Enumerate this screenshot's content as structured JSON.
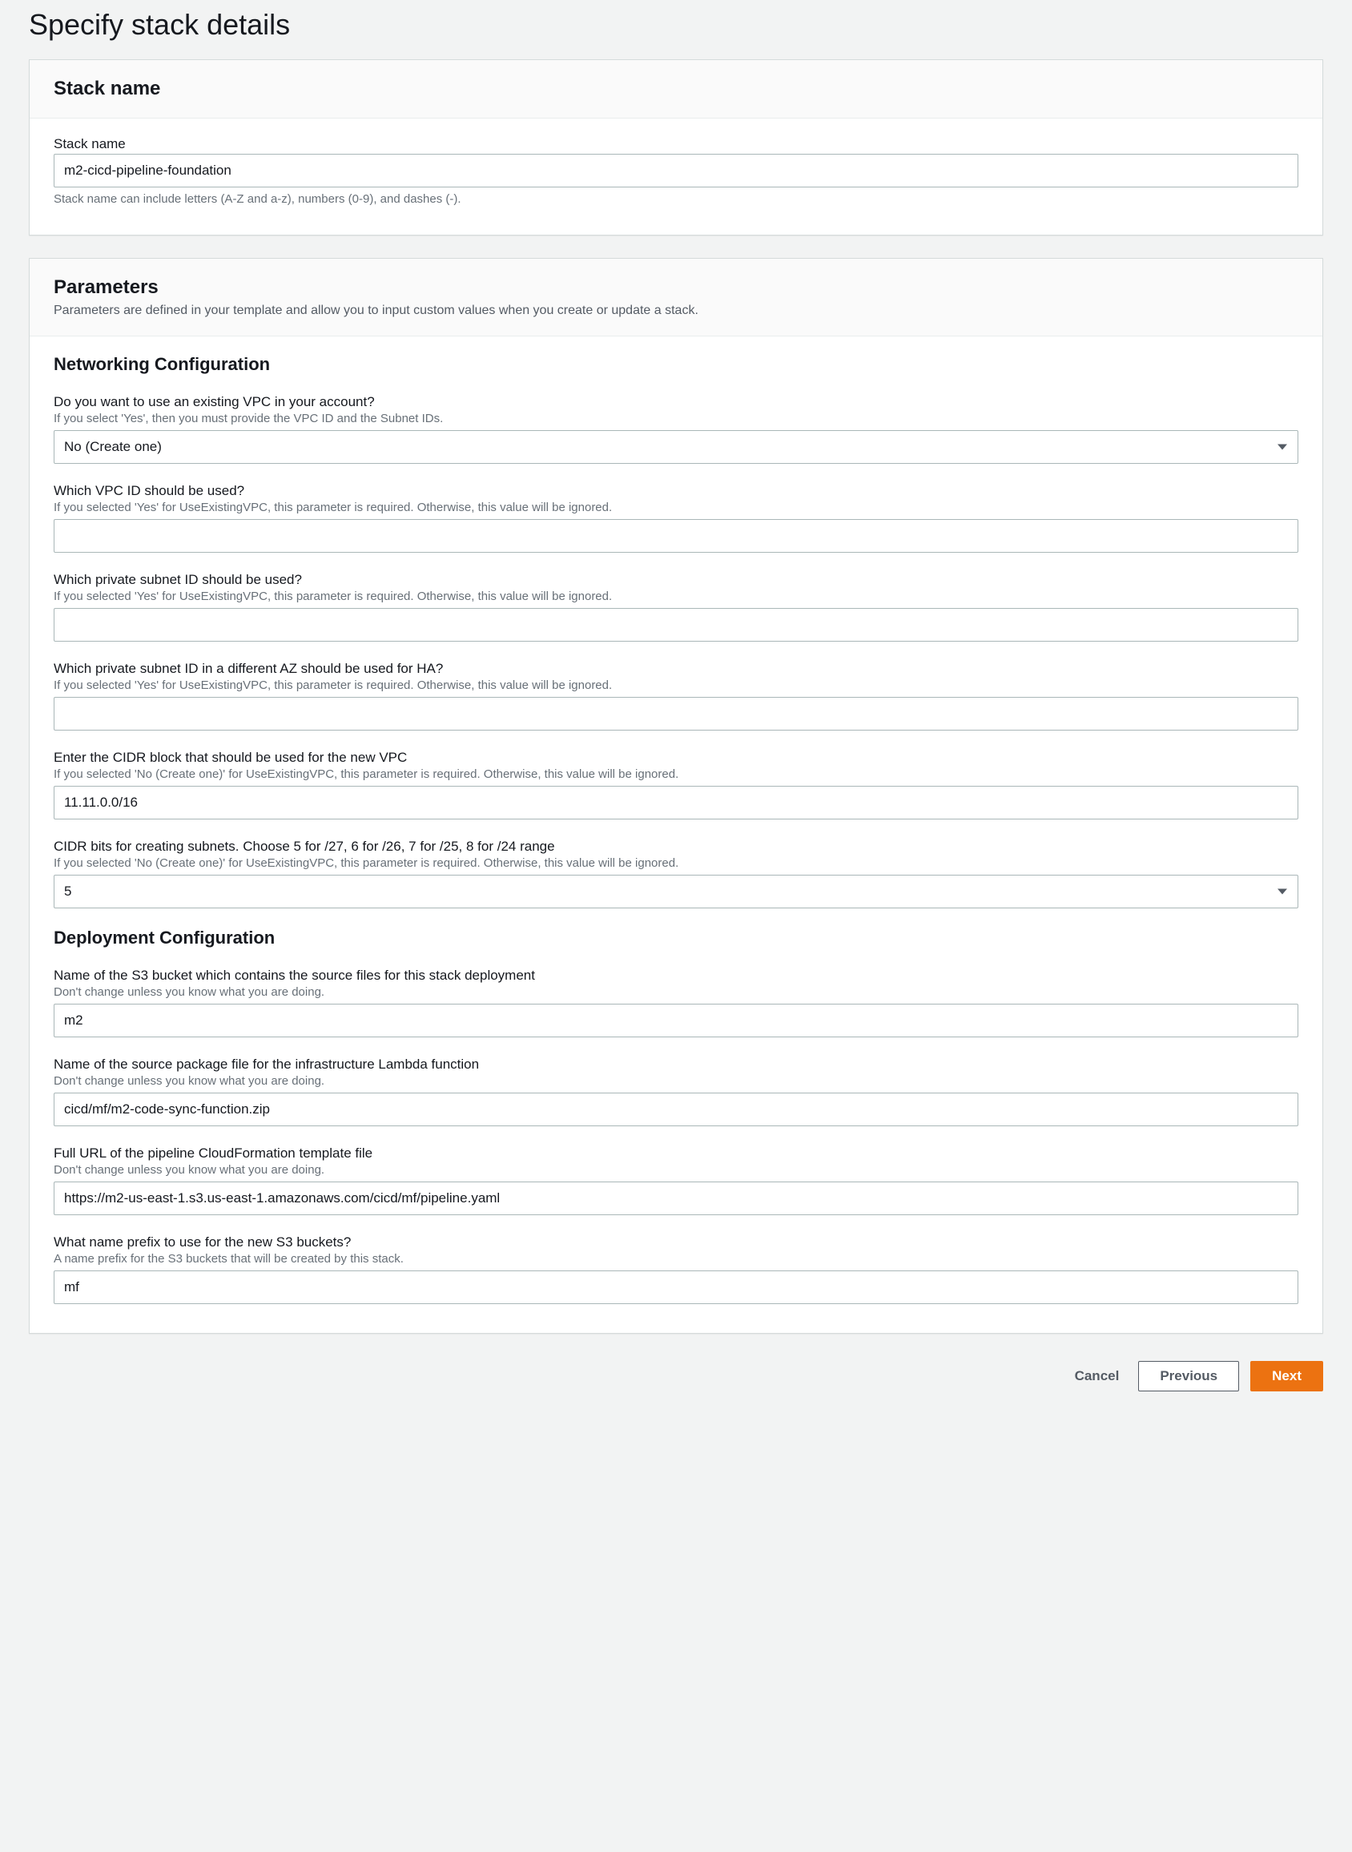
{
  "page": {
    "title": "Specify stack details"
  },
  "stack_name_section": {
    "heading": "Stack name",
    "field_label": "Stack name",
    "value": "m2-cicd-pipeline-foundation",
    "hint": "Stack name can include letters (A-Z and a-z), numbers (0-9), and dashes (-)."
  },
  "parameters_section": {
    "heading": "Parameters",
    "sub": "Parameters are defined in your template and allow you to input custom values when you create or update a stack."
  },
  "networking": {
    "heading": "Networking Configuration",
    "use_existing_vpc": {
      "label": "Do you want to use an existing VPC in your account?",
      "hint": "If you select 'Yes', then you must provide the VPC ID and the Subnet IDs.",
      "value": "No (Create one)"
    },
    "vpc_id": {
      "label": "Which VPC ID should be used?",
      "hint": "If you selected 'Yes' for UseExistingVPC, this parameter is required. Otherwise, this value will be ignored.",
      "value": ""
    },
    "subnet1": {
      "label": "Which private subnet ID should be used?",
      "hint": "If you selected 'Yes' for UseExistingVPC, this parameter is required. Otherwise, this value will be ignored.",
      "value": ""
    },
    "subnet2": {
      "label": "Which private subnet ID in a different AZ should be used for HA?",
      "hint": "If you selected 'Yes' for UseExistingVPC, this parameter is required. Otherwise, this value will be ignored.",
      "value": ""
    },
    "cidr_block": {
      "label": "Enter the CIDR block that should be used for the new VPC",
      "hint": "If you selected 'No (Create one)' for UseExistingVPC, this parameter is required. Otherwise, this value will be ignored.",
      "value": "11.11.0.0/16"
    },
    "cidr_bits": {
      "label": "CIDR bits for creating subnets. Choose 5 for /27, 6 for /26, 7 for /25, 8 for /24 range",
      "hint": "If you selected 'No (Create one)' for UseExistingVPC, this parameter is required. Otherwise, this value will be ignored.",
      "value": "5"
    }
  },
  "deployment": {
    "heading": "Deployment Configuration",
    "s3_bucket": {
      "label": "Name of the S3 bucket which contains the source files for this stack deployment",
      "hint": "Don't change unless you know what you are doing.",
      "value": "m2"
    },
    "lambda_pkg": {
      "label": "Name of the source package file for the infrastructure Lambda function",
      "hint": "Don't change unless you know what you are doing.",
      "value": "cicd/mf/m2-code-sync-function.zip"
    },
    "template_url": {
      "label": "Full URL of the pipeline CloudFormation template file",
      "hint": "Don't change unless you know what you are doing.",
      "value": "https://m2-us-east-1.s3.us-east-1.amazonaws.com/cicd/mf/pipeline.yaml"
    },
    "s3_prefix": {
      "label": "What name prefix to use for the new S3 buckets?",
      "hint": "A name prefix for the S3 buckets that will be created by this stack.",
      "value": "mf"
    }
  },
  "footer": {
    "cancel": "Cancel",
    "previous": "Previous",
    "next": "Next"
  }
}
